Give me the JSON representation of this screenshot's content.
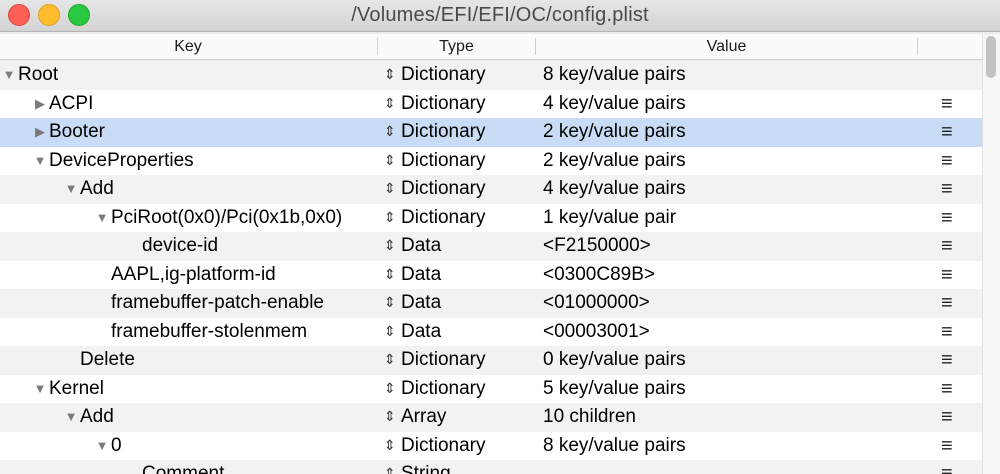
{
  "window": {
    "title": "/Volumes/EFI/EFI/OC/config.plist"
  },
  "header": {
    "key": "Key",
    "type": "Type",
    "value": "Value"
  },
  "rows": [
    {
      "key": "Root",
      "disclosure": "expanded",
      "indent": 0,
      "type": "Dictionary",
      "value": "8 key/value pairs",
      "menu": false
    },
    {
      "key": "ACPI",
      "disclosure": "collapsed",
      "indent": 1,
      "type": "Dictionary",
      "value": "4 key/value pairs",
      "menu": true
    },
    {
      "key": "Booter",
      "disclosure": "collapsed",
      "indent": 1,
      "type": "Dictionary",
      "value": "2 key/value pairs",
      "menu": true,
      "selected": true
    },
    {
      "key": "DeviceProperties",
      "disclosure": "expanded",
      "indent": 1,
      "type": "Dictionary",
      "value": "2 key/value pairs",
      "menu": true
    },
    {
      "key": "Add",
      "disclosure": "expanded",
      "indent": 2,
      "type": "Dictionary",
      "value": "4 key/value pairs",
      "menu": true
    },
    {
      "key": "PciRoot(0x0)/Pci(0x1b,0x0)",
      "disclosure": "expanded",
      "indent": 3,
      "type": "Dictionary",
      "value": "1 key/value pair",
      "menu": true
    },
    {
      "key": "device-id",
      "disclosure": "none",
      "indent": 4,
      "type": "Data",
      "value": "<F2150000>",
      "menu": true
    },
    {
      "key": "AAPL,ig-platform-id",
      "disclosure": "none",
      "indent": 3,
      "type": "Data",
      "value": "<0300C89B>",
      "menu": true
    },
    {
      "key": "framebuffer-patch-enable",
      "disclosure": "none",
      "indent": 3,
      "type": "Data",
      "value": "<01000000>",
      "menu": true
    },
    {
      "key": "framebuffer-stolenmem",
      "disclosure": "none",
      "indent": 3,
      "type": "Data",
      "value": "<00003001>",
      "menu": true
    },
    {
      "key": "Delete",
      "disclosure": "none",
      "indent": 2,
      "type": "Dictionary",
      "value": "0 key/value pairs",
      "menu": true
    },
    {
      "key": "Kernel",
      "disclosure": "expanded",
      "indent": 1,
      "type": "Dictionary",
      "value": "5 key/value pairs",
      "menu": true
    },
    {
      "key": "Add",
      "disclosure": "expanded",
      "indent": 2,
      "type": "Array",
      "value": "10 children",
      "menu": true
    },
    {
      "key": "0",
      "disclosure": "expanded",
      "indent": 3,
      "type": "Dictionary",
      "value": "8 key/value pairs",
      "menu": true
    },
    {
      "key": "Comment",
      "disclosure": "none",
      "indent": 4,
      "type": "String",
      "value": "",
      "menu": true
    }
  ],
  "icons": {
    "expanded": "▼",
    "collapsed": "▶",
    "type_stepper": "⇕",
    "row_menu": "≡"
  }
}
